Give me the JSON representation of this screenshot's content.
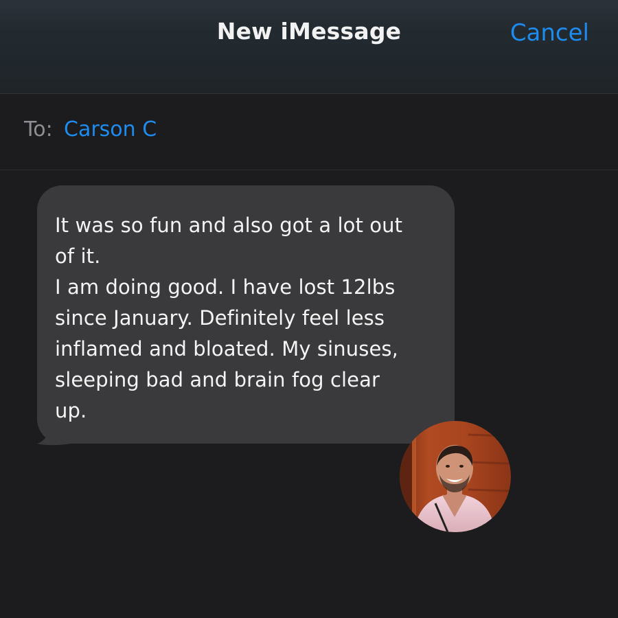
{
  "header": {
    "title": "New iMessage",
    "cancel_label": "Cancel"
  },
  "recipient": {
    "label": "To:",
    "name": "Carson C"
  },
  "message": {
    "text": "It was so fun and also got a lot out\nof it.\nI am doing good. I have lost 12lbs\nsince January. Definitely feel less\ninflamed and bloated. My sinuses,\nsleeping bad and brain fog clear\nup."
  },
  "avatar": {
    "icon": "person-photo"
  },
  "colors": {
    "accent": "#1d8cf0",
    "background": "#1c1c1e",
    "bubble": "#3a3a3c"
  }
}
